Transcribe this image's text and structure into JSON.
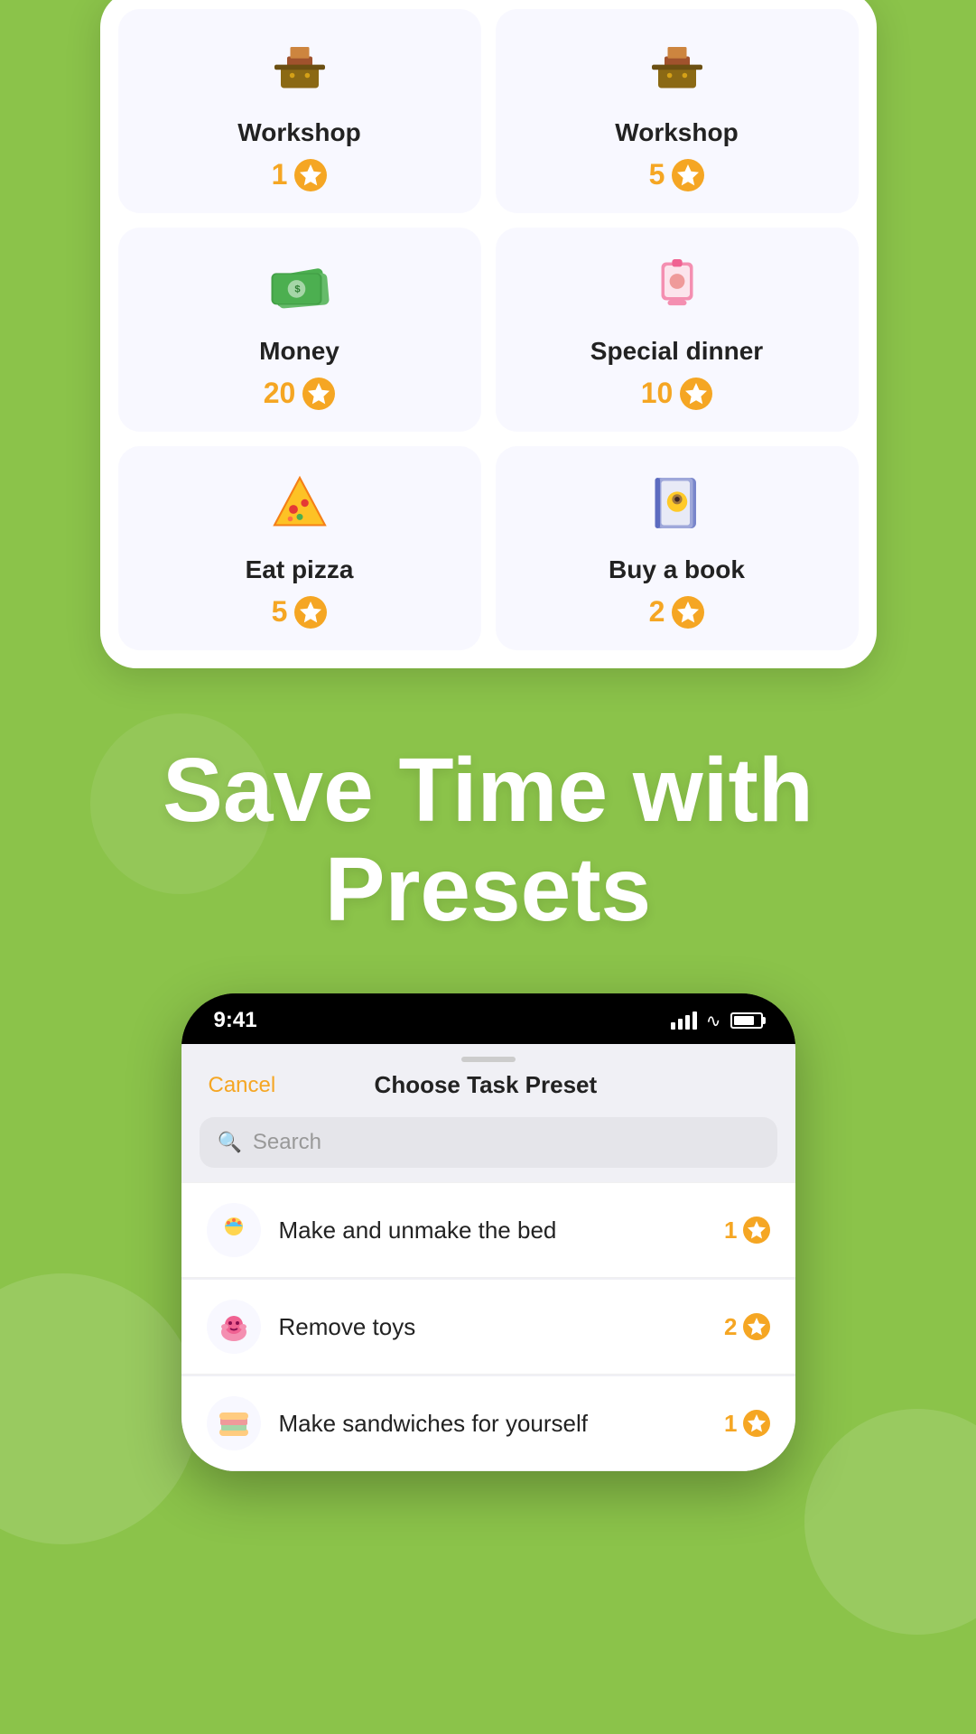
{
  "top_phone": {
    "rewards": [
      {
        "id": "workshop1",
        "icon": "🔧",
        "name": "Workshop",
        "points": "1"
      },
      {
        "id": "workshop5",
        "icon": "🔧",
        "name": "Workshop",
        "points": "5"
      },
      {
        "id": "money",
        "icon": "💵",
        "name": "Money",
        "points": "20"
      },
      {
        "id": "special-dinner",
        "icon": "🍽️",
        "name": "Special dinner",
        "points": "10"
      },
      {
        "id": "eat-pizza",
        "icon": "🍕",
        "name": "Eat pizza",
        "points": "5"
      },
      {
        "id": "buy-book",
        "icon": "📖",
        "name": "Buy a book",
        "points": "2"
      }
    ]
  },
  "headline": {
    "line1": "Save Time with",
    "line2": "Presets"
  },
  "bottom_phone": {
    "status_bar": {
      "time": "9:41"
    },
    "drag_handle": true,
    "modal": {
      "cancel_label": "Cancel",
      "title": "Choose Task Preset",
      "search_placeholder": "Search"
    },
    "tasks": [
      {
        "id": "make-bed",
        "icon": "🎉",
        "name": "Make and unmake the bed",
        "points": "1"
      },
      {
        "id": "remove-toys",
        "icon": "🐷",
        "name": "Remove toys",
        "points": "2"
      },
      {
        "id": "make-sandwiches",
        "icon": "🥪",
        "name": "Make sandwiches for yourself",
        "points": "1"
      }
    ]
  },
  "colors": {
    "background": "#8BC34A",
    "accent_orange": "#F5A623",
    "card_bg": "#f8f8ff"
  }
}
